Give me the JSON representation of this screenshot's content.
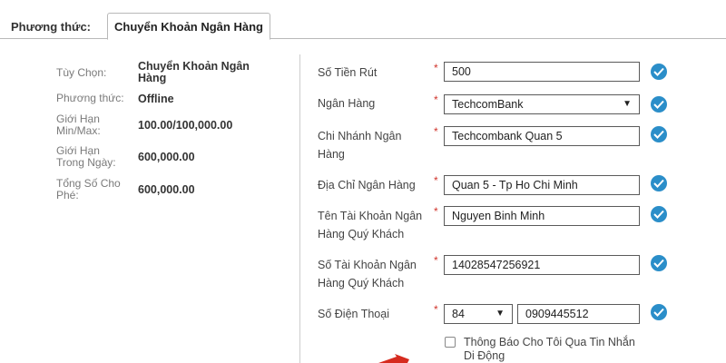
{
  "tabs": {
    "static_label": "Phương thức:",
    "active_label": "Chuyển Khoản Ngân Hàng"
  },
  "info": {
    "option_label": "Tùy Chọn:",
    "option_value": "Chuyển Khoản Ngân Hàng",
    "method_label": "Phương thức:",
    "method_value": "Offline",
    "minmax_label": "Giới Hạn Min/Max:",
    "minmax_value": "100.00/100,000.00",
    "daily_label": "Giới Hạn Trong Ngày:",
    "daily_value": "600,000.00",
    "total_label": "Tổng Số Cho Phé:",
    "total_value": "600,000.00"
  },
  "form": {
    "required_mark": "*",
    "amount_label": "Số Tiền Rút",
    "amount_value": "500",
    "bank_label": "Ngân Hàng",
    "bank_value": "TechcomBank",
    "branch_label": "Chi Nhánh Ngân Hàng",
    "branch_value": "Techcombank Quan 5",
    "address_label": "Địa Chỉ Ngân Hàng",
    "address_value": "Quan 5 - Tp Ho Chi Minh",
    "account_name_label": "Tên Tài Khoản Ngân Hàng Quý Khách",
    "account_name_value": "Nguyen Binh Minh",
    "account_number_label": "Số Tài Khoản Ngân Hàng Quý Khách",
    "account_number_value": "14028547256921",
    "phone_label": "Số Điện Thoại",
    "phone_code_value": "84",
    "phone_value": "0909445512",
    "sms_notify_label": "Thông Báo Cho Tôi Qua Tin Nhắn Di Động",
    "sms_notify_checked": false
  },
  "colors": {
    "check_badge": "#2b8ec9",
    "required": "#d0342c",
    "arrow": "#d62b1f"
  },
  "icons": {
    "valid": "checkmark-circle-icon",
    "dropdown": "chevron-down-icon",
    "pointer": "red-arrow-icon"
  }
}
